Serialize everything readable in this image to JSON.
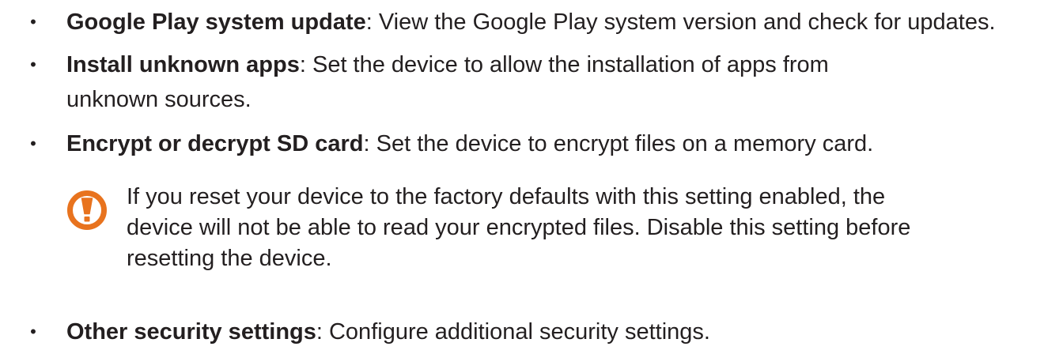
{
  "items": [
    {
      "term": "Google Play system update",
      "description": ": View the Google Play system version and check for updates."
    },
    {
      "term": "Install unknown apps",
      "description": ": Set the device to allow the installation of apps from unknown sources."
    },
    {
      "term": "Encrypt or decrypt SD card",
      "description": ": Set the device to encrypt files on a memory card."
    },
    {
      "term": "Other security settings",
      "description": ": Configure additional security settings."
    }
  ],
  "bullet_symbol": "•",
  "warning": {
    "icon": "caution-exclamation-icon",
    "text": "If you reset your device to the factory defaults with this setting enabled, the device will not be able to read your encrypted files. Disable this setting before resetting the device."
  },
  "colors": {
    "text": "#231f20",
    "warning_icon": "#e8731e"
  }
}
